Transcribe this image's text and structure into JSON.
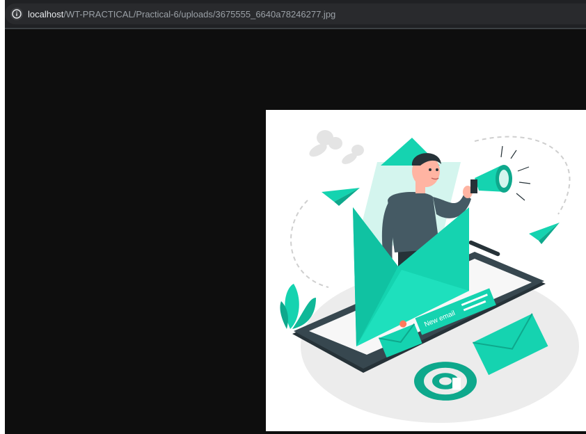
{
  "browser": {
    "address_bar": {
      "host": "localhost",
      "path": "/WT-PRACTICAL/Practical-6/uploads/3675555_6640a78246277.jpg",
      "icon": "info-icon"
    }
  },
  "image": {
    "subject": "email marketing illustration",
    "email_label": "New email",
    "accent_color": "#15d3b0",
    "dark_color": "#263238"
  }
}
